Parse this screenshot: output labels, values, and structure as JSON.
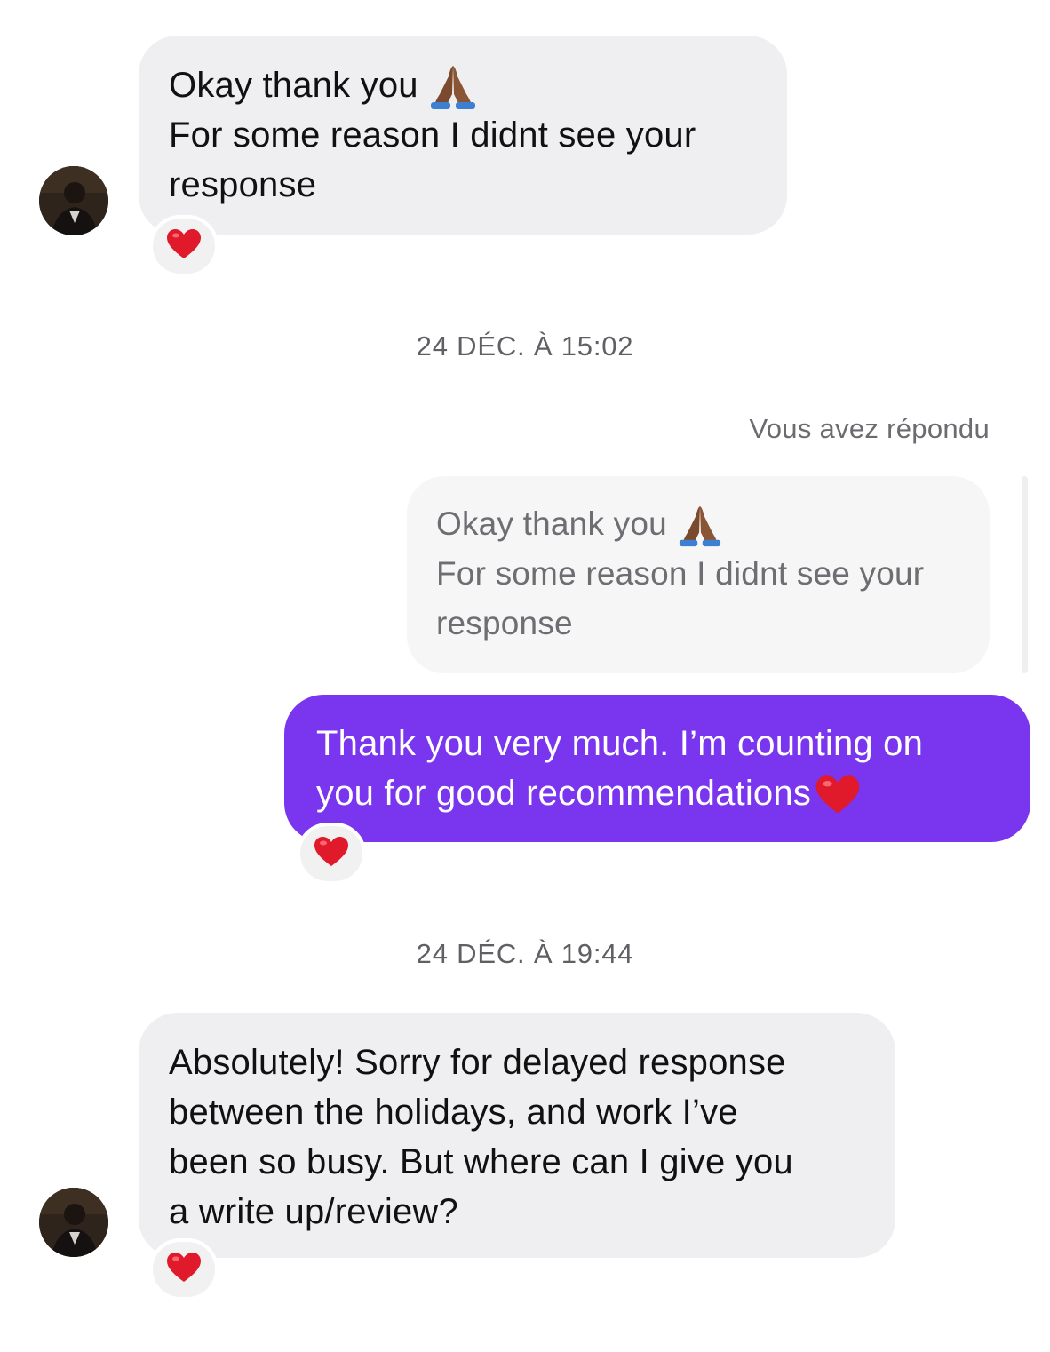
{
  "conversation": {
    "messages": [
      {
        "lines": [
          "Okay thank you",
          "For some reason I didnt see your",
          "response"
        ],
        "emoji": "folded-hands",
        "reaction": "heart"
      },
      {
        "timestamp": "24 DÉC. À 15:02",
        "reply_label": "Vous avez répondu",
        "quoted_lines": [
          "Okay thank you",
          "For some reason I didnt see your",
          "response"
        ],
        "lines": [
          "Thank you very much. I’m counting on",
          "you for good recommendations"
        ],
        "emoji": "heart",
        "reaction": "heart"
      },
      {
        "timestamp": "24 DÉC. À 19:44",
        "lines": [
          "Absolutely! Sorry for delayed response",
          "between the holidays, and work I’ve",
          "been so busy. But where can I give you",
          "a write up/review?"
        ],
        "reaction": "heart"
      }
    ]
  },
  "colors": {
    "incoming_bubble": "#efeff1",
    "outgoing_bubble": "#7a35ef",
    "timestamp_text": "#5f5f64",
    "heart": "#e0192b"
  },
  "icons": [
    "avatar-photo",
    "folded-hands-icon",
    "heart-icon"
  ]
}
